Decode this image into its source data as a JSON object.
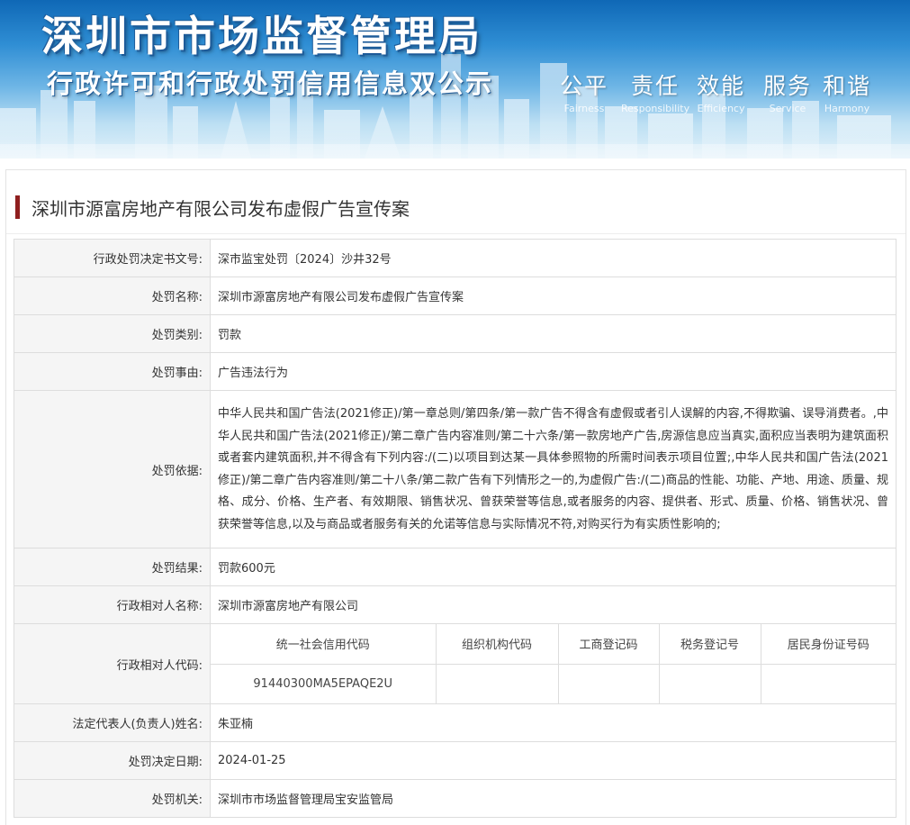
{
  "banner": {
    "title": "深圳市市场监督管理局",
    "subtitle": "行政许可和行政处罚信用信息双公示",
    "slogans": [
      {
        "cn": "公平",
        "en": "Fairness"
      },
      {
        "cn": "责任",
        "en": "Responsibility"
      },
      {
        "cn": "效能",
        "en": "Efficiency"
      },
      {
        "cn": "服务",
        "en": "Service"
      },
      {
        "cn": "和谐",
        "en": "Harmony"
      }
    ]
  },
  "page": {
    "case_title": "深圳市源富房地产有限公司发布虚假广告宣传案"
  },
  "record": {
    "doc_no": {
      "label": "行政处罚决定书文号:",
      "value": "深市监宝处罚〔2024〕沙井32号"
    },
    "name": {
      "label": "处罚名称:",
      "value": "深圳市源富房地产有限公司发布虚假广告宣传案"
    },
    "category": {
      "label": "处罚类别:",
      "value": "罚款"
    },
    "reason": {
      "label": "处罚事由:",
      "value": "广告违法行为"
    },
    "basis": {
      "label": "处罚依据:",
      "value": "中华人民共和国广告法(2021修正)/第一章总则/第四条/第一款广告不得含有虚假或者引人误解的内容,不得欺骗、误导消费者。,中华人民共和国广告法(2021修正)/第二章广告内容准则/第二十六条/第一款房地产广告,房源信息应当真实,面积应当表明为建筑面积或者套内建筑面积,并不得含有下列内容:/(二)以项目到达某一具体参照物的所需时间表示项目位置;,中华人民共和国广告法(2021修正)/第二章广告内容准则/第二十八条/第二款广告有下列情形之一的,为虚假广告:/(二)商品的性能、功能、产地、用途、质量、规格、成分、价格、生产者、有效期限、销售状况、曾获荣誉等信息,或者服务的内容、提供者、形式、质量、价格、销售状况、曾获荣誉等信息,以及与商品或者服务有关的允诺等信息与实际情况不符,对购买行为有实质性影响的;"
    },
    "result": {
      "label": "处罚结果:",
      "value": "罚款600元"
    },
    "party_name": {
      "label": "行政相对人名称:",
      "value": "深圳市源富房地产有限公司"
    },
    "party_code": {
      "label": "行政相对人代码:",
      "headers": [
        "统一社会信用代码",
        "组织机构代码",
        "工商登记码",
        "税务登记号",
        "居民身份证号码"
      ],
      "values": [
        "91440300MA5EPAQE2U",
        "",
        "",
        "",
        ""
      ]
    },
    "legal_rep": {
      "label": "法定代表人(负责人)姓名:",
      "value": "朱亚楠"
    },
    "decision_date": {
      "label": "处罚决定日期:",
      "value": "2024-01-25"
    },
    "authority": {
      "label": "处罚机关:",
      "value": "深圳市市场监督管理局宝安监管局"
    }
  }
}
